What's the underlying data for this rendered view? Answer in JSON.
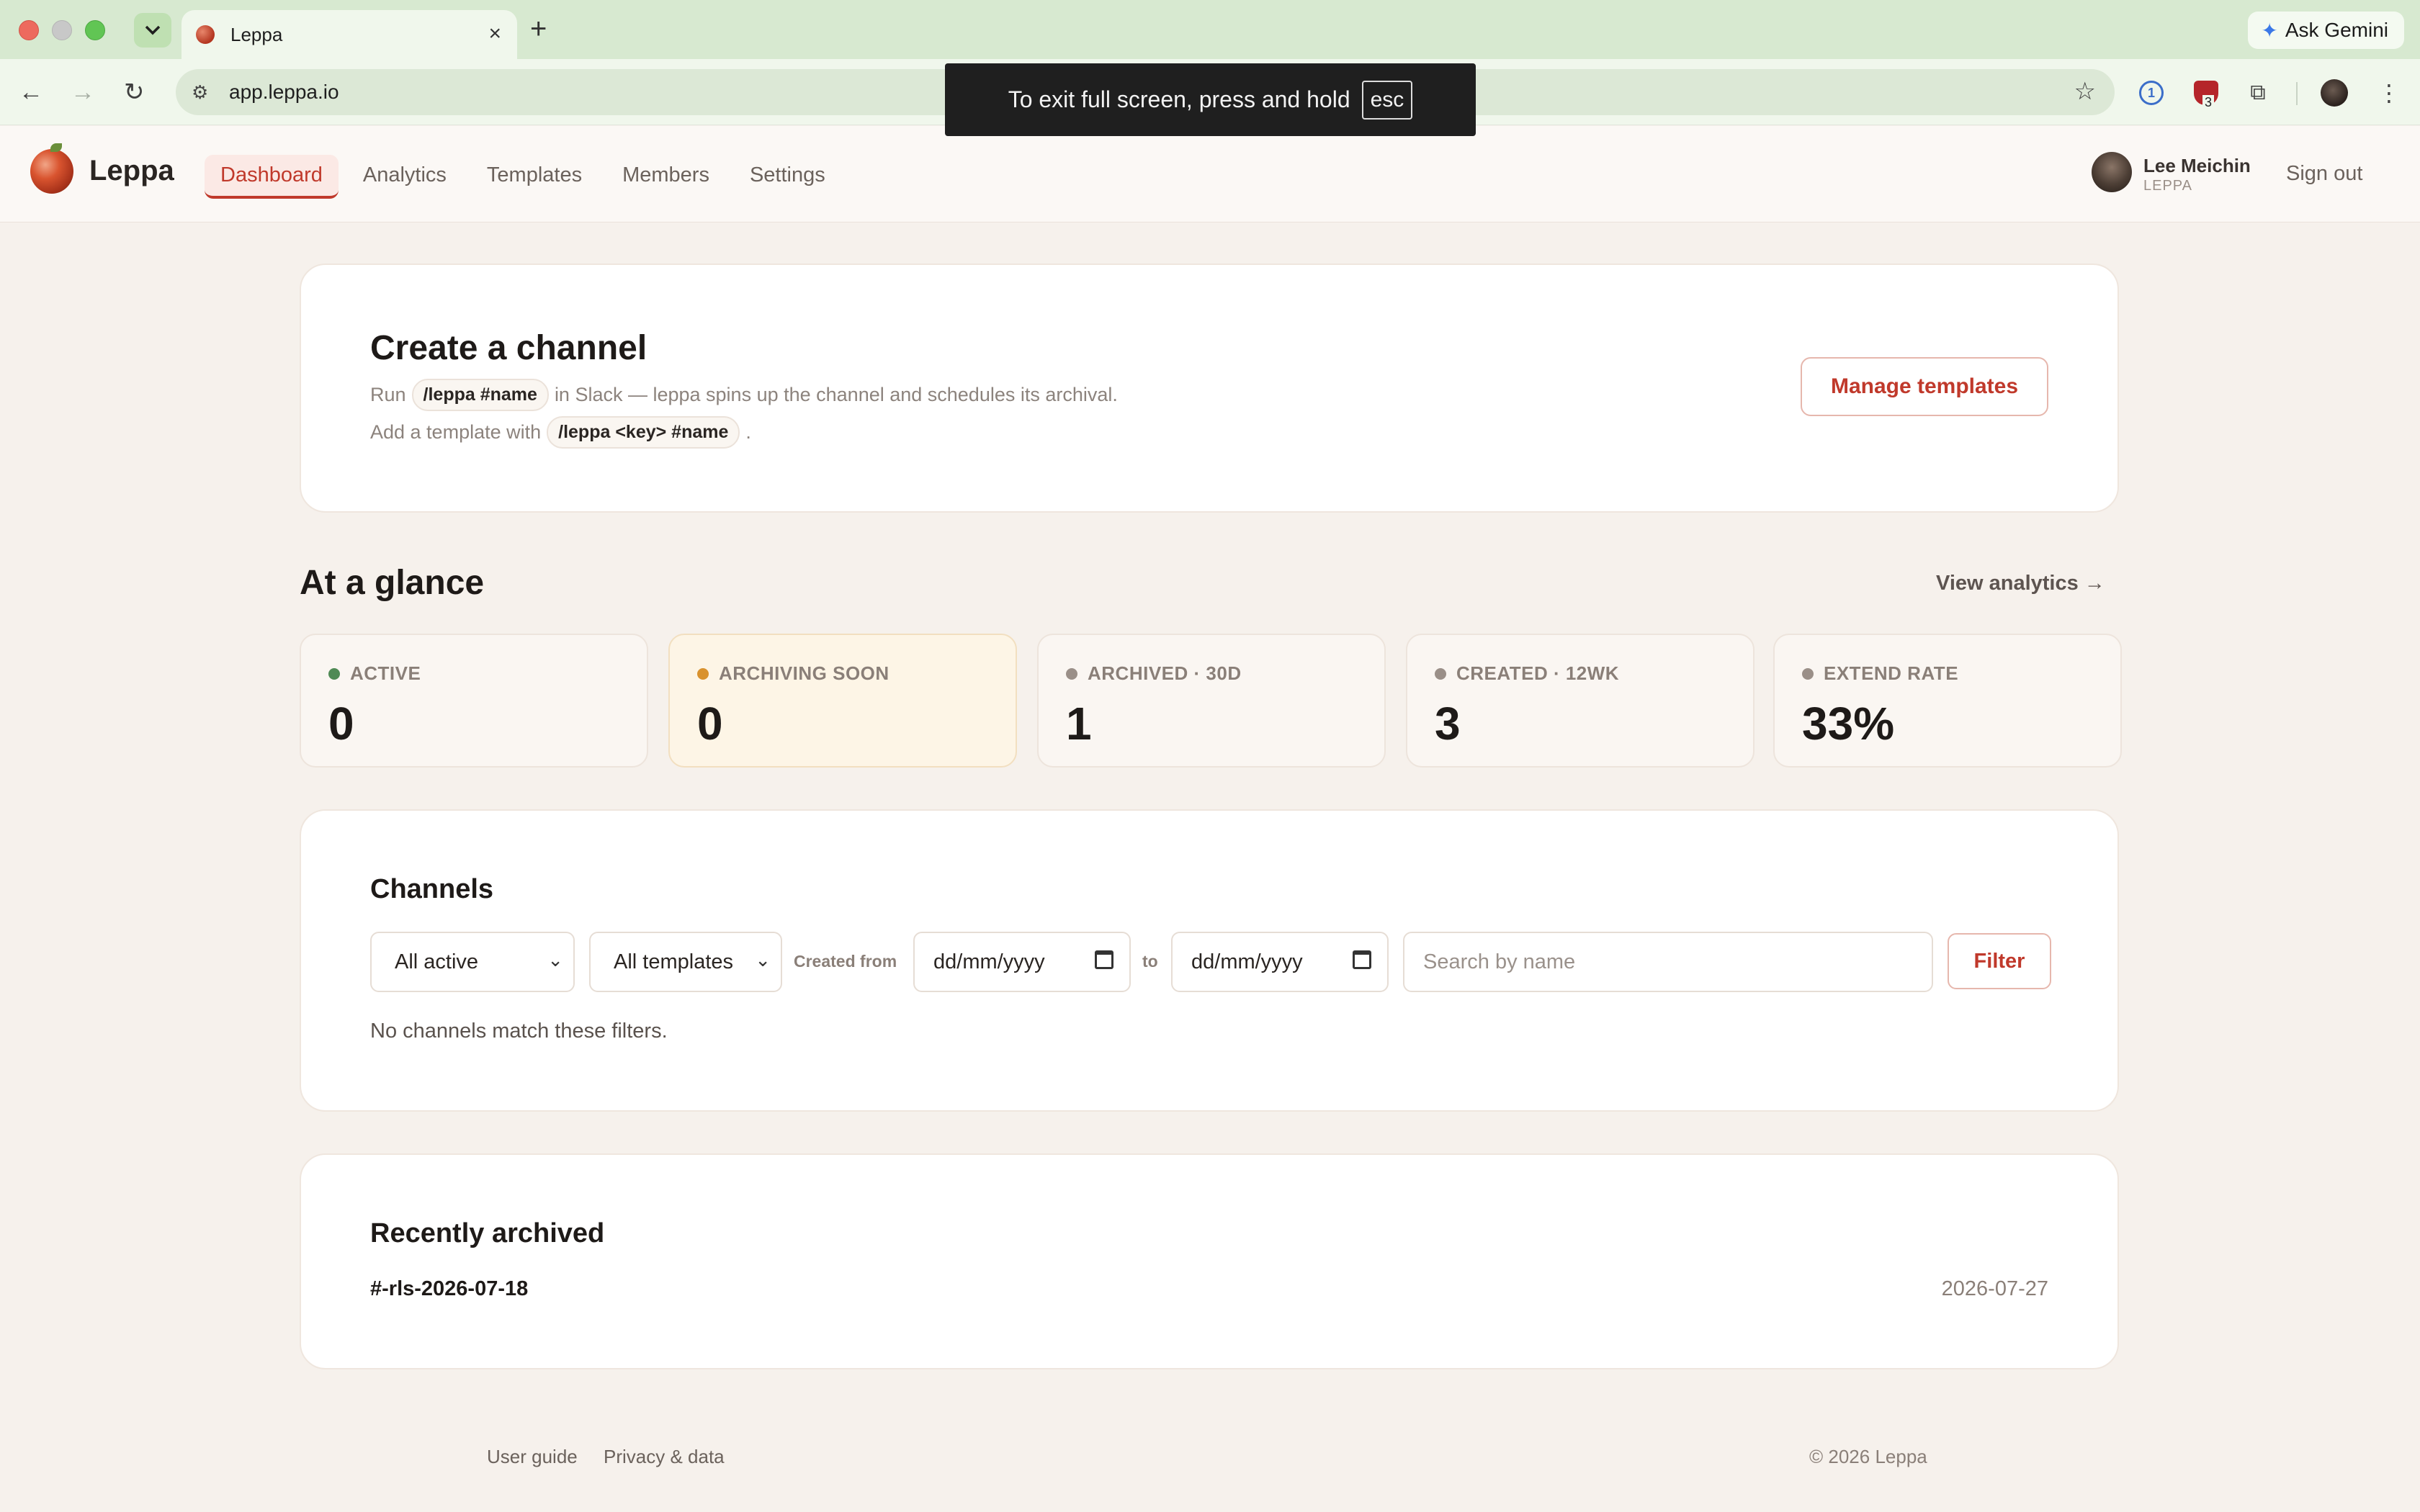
{
  "browser": {
    "tab_title": "Leppa",
    "url": "app.leppa.io",
    "ask_gemini": "Ask Gemini",
    "fullscreen_toast": "To exit full screen, press and hold",
    "fullscreen_key": "esc",
    "extension_badge": "3"
  },
  "header": {
    "logo_text": "Leppa",
    "nav": [
      {
        "label": "Dashboard",
        "active": true
      },
      {
        "label": "Analytics"
      },
      {
        "label": "Templates"
      },
      {
        "label": "Members"
      },
      {
        "label": "Settings"
      }
    ],
    "user_name": "Lee Meichin",
    "user_org": "LEPPA",
    "sign_out": "Sign out"
  },
  "create": {
    "title": "Create a channel",
    "line1_prefix": "Run",
    "line1_code": "/leppa #name",
    "line1_suffix": "in Slack — leppa spins up the channel and schedules its archival.",
    "line2_prefix": "Add a template with",
    "line2_code": "/leppa <key> #name",
    "line2_suffix": ".",
    "manage_button": "Manage templates"
  },
  "glance": {
    "title": "At a glance",
    "view_analytics": "View analytics →",
    "stats": [
      {
        "label": "ACTIVE",
        "value": "0",
        "color": "#4f8a55"
      },
      {
        "label": "ARCHIVING SOON",
        "value": "0",
        "color": "#d9922e"
      },
      {
        "label": "ARCHIVED · 30D",
        "value": "1",
        "color": "#9a8f88"
      },
      {
        "label": "CREATED · 12WK",
        "value": "3",
        "color": "#9a8f88"
      },
      {
        "label": "EXTEND RATE",
        "value": "33%",
        "color": "#9a8f88"
      }
    ]
  },
  "channels": {
    "title": "Channels",
    "status_select": "All active",
    "template_select": "All templates",
    "created_from_label": "Created from",
    "date_from": "dd/mm/yyyy",
    "to_label": "to",
    "date_to": "dd/mm/yyyy",
    "search_placeholder": "Search by name",
    "filter_button": "Filter",
    "empty_message": "No channels match these filters."
  },
  "archived": {
    "title": "Recently archived",
    "items": [
      {
        "name": "#-rls-2026-07-18",
        "date": "2026-07-27"
      }
    ]
  },
  "footer": {
    "user_guide": "User guide",
    "privacy": "Privacy & data",
    "copyright": "© 2026 Leppa"
  },
  "colors": {
    "accent": "#c0392b",
    "background": "#f6f1ec"
  }
}
